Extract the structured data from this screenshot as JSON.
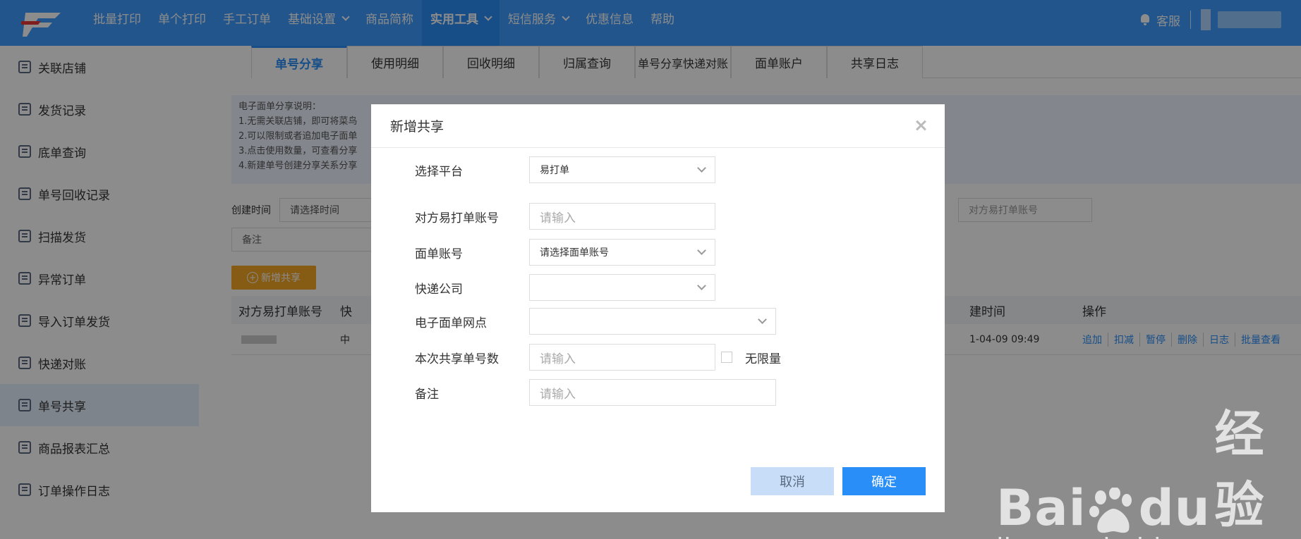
{
  "topbar": {
    "nav": [
      {
        "label": "批量打印",
        "dropdown": false
      },
      {
        "label": "单个打印",
        "dropdown": false
      },
      {
        "label": "手工订单",
        "dropdown": false
      },
      {
        "label": "基础设置",
        "dropdown": true
      },
      {
        "label": "商品简称",
        "dropdown": false
      },
      {
        "label": "实用工具",
        "dropdown": true,
        "active": true
      },
      {
        "label": "短信服务",
        "dropdown": true
      },
      {
        "label": "优惠信息",
        "dropdown": false
      },
      {
        "label": "帮助",
        "dropdown": false
      }
    ],
    "service_label": "客服"
  },
  "sidebar": {
    "items": [
      {
        "label": "关联店铺"
      },
      {
        "label": "发货记录"
      },
      {
        "label": "底单查询"
      },
      {
        "label": "单号回收记录"
      },
      {
        "label": "扫描发货"
      },
      {
        "label": "异常订单"
      },
      {
        "label": "导入订单发货"
      },
      {
        "label": "快递对账"
      },
      {
        "label": "单号共享",
        "active": true
      },
      {
        "label": "商品报表汇总"
      },
      {
        "label": "订单操作日志"
      }
    ]
  },
  "main": {
    "tabs": [
      "单号分享",
      "使用明细",
      "回收明细",
      "归属查询",
      "单号分享快递对账",
      "面单账户",
      "共享日志"
    ],
    "notice": {
      "title": "电子面单分享说明：",
      "lines": [
        "1.无需关联店铺，即可将菜鸟",
        "2.可以限制或者追加电子面单",
        "3.点击使用数量，可查看分享",
        "4.新建单号创建分享关系分享"
      ]
    },
    "filter": {
      "create_time_label": "创建时间",
      "time_placeholder": "请选择时间",
      "account_placeholder": "对方易打单账号",
      "remark_placeholder": "备注"
    },
    "add_share_button": "新增共享",
    "table": {
      "headers": [
        "对方易打单账号",
        "快",
        "建时间",
        "操作"
      ],
      "row": {
        "col2": "中",
        "time": "1-04-09 09:49",
        "ops": [
          "追加",
          "扣减",
          "暂停",
          "删除",
          "日志",
          "批量查看"
        ]
      }
    }
  },
  "modal": {
    "title": "新增共享",
    "fields": {
      "platform": {
        "label": "选择平台",
        "value": "易打单"
      },
      "account": {
        "label": "对方易打单账号",
        "placeholder": "请输入"
      },
      "waybill_account": {
        "label": "面单账号",
        "value": "请选择面单账号"
      },
      "express": {
        "label": "快递公司",
        "value": ""
      },
      "branch": {
        "label": "电子面单网点",
        "value": ""
      },
      "quantity": {
        "label": "本次共享单号数",
        "placeholder": "请输入",
        "unlimited_label": "无限量"
      },
      "remark": {
        "label": "备注",
        "placeholder": "请输入"
      }
    },
    "cancel_label": "取消",
    "confirm_label": "确定"
  },
  "watermark": {
    "brand": "Bai",
    "brand2": "du",
    "cn": "经验",
    "url": "jingyan.baidu.com"
  },
  "colors": {
    "primary": "#2a8ef8",
    "topbar": "#3d9bff",
    "orange": "#f5a623"
  }
}
